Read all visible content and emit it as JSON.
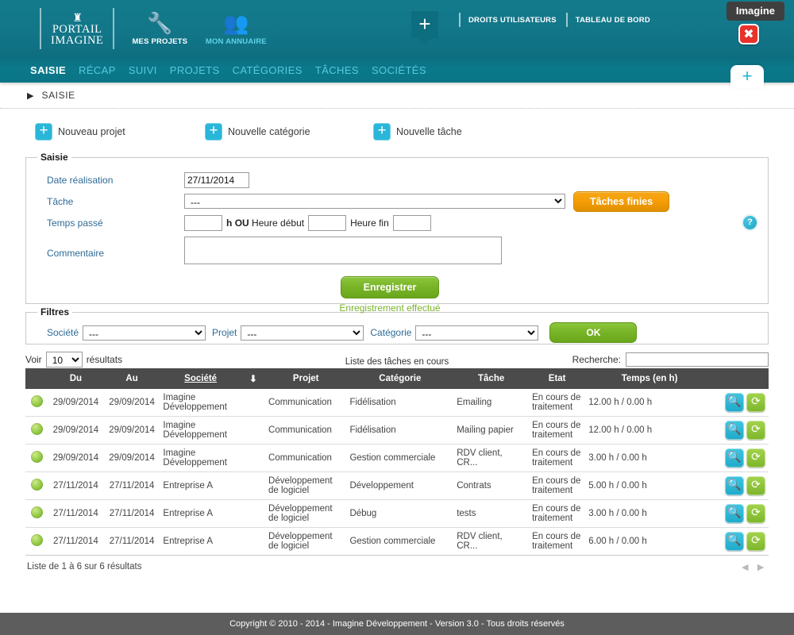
{
  "header": {
    "logo_line1": "PORTAIL",
    "logo_line2": "IMAGINE",
    "items": [
      {
        "icon": "wrench-icon",
        "label": "MES PROJETS"
      },
      {
        "icon": "people-icon",
        "label": "MON ANNUAIRE"
      }
    ],
    "plus_label": "+",
    "links": [
      {
        "label": "DROITS UTILISATEURS"
      },
      {
        "label": "TABLEAU DE BORD"
      }
    ],
    "user_badge": "Imagine",
    "close_label": "✖"
  },
  "nav": {
    "items": [
      {
        "label": "SAISIE",
        "active": true
      },
      {
        "label": "RÉCAP",
        "active": false
      },
      {
        "label": "SUIVI",
        "active": false
      },
      {
        "label": "PROJETS",
        "active": false
      },
      {
        "label": "CATÉGORIES",
        "active": false
      },
      {
        "label": "TÂCHES",
        "active": false
      },
      {
        "label": "SOCIÉTÉS",
        "active": false
      }
    ],
    "plus_tab": "+"
  },
  "breadcrumb": {
    "label": "SAISIE"
  },
  "actions": [
    {
      "label": "Nouveau projet"
    },
    {
      "label": "Nouvelle catégorie"
    },
    {
      "label": "Nouvelle tâche"
    }
  ],
  "saisie": {
    "legend": "Saisie",
    "date_label": "Date réalisation",
    "date_value": "27/11/2014",
    "tache_label": "Tâche",
    "tache_value": "---",
    "taches_finies_button": "Tâches finies",
    "help_icon": "?",
    "temps_label": "Temps passé",
    "temps_value": "",
    "h_label": "h",
    "ou_label": "OU",
    "heure_debut_label": "Heure début",
    "heure_debut_value": "",
    "heure_fin_label": "Heure fin",
    "heure_fin_value": "",
    "commentaire_label": "Commentaire",
    "commentaire_value": "",
    "save_button": "Enregistrer",
    "save_message": "Enregistrement effectué"
  },
  "filtres": {
    "legend": "Filtres",
    "societe_label": "Société",
    "societe_value": "---",
    "projet_label": "Projet",
    "projet_value": "---",
    "categorie_label": "Catégorie",
    "categorie_value": "---",
    "ok_button": "OK"
  },
  "toolbar": {
    "voir_label": "Voir",
    "page_size": "10",
    "resultats_label": "résultats",
    "recherche_label": "Recherche:",
    "recherche_value": ""
  },
  "table": {
    "title": "Liste des tâches en cours",
    "columns": [
      "",
      "Du",
      "Au",
      "Société",
      "",
      "Projet",
      "Catégorie",
      "Tâche",
      "Etat",
      "Temps (en h)",
      ""
    ],
    "sorted_column": "Société",
    "sort_icon": "arrow-down-icon",
    "rows": [
      {
        "status": "green",
        "du": "29/09/2014",
        "au": "29/09/2014",
        "societe": "Imagine Développement",
        "projet": "Communication",
        "categorie": "Fidélisation",
        "tache": "Emailing",
        "etat": "En cours de traitement",
        "temps": "12.00 h / 0.00 h"
      },
      {
        "status": "green",
        "du": "29/09/2014",
        "au": "29/09/2014",
        "societe": "Imagine Développement",
        "projet": "Communication",
        "categorie": "Fidélisation",
        "tache": "Mailing papier",
        "etat": "En cours de traitement",
        "temps": "12.00 h / 0.00 h"
      },
      {
        "status": "green",
        "du": "29/09/2014",
        "au": "29/09/2014",
        "societe": "Imagine Développement",
        "projet": "Communication",
        "categorie": "Gestion commerciale",
        "tache": "RDV client, CR...",
        "etat": "En cours de traitement",
        "temps": "3.00 h / 0.00 h"
      },
      {
        "status": "green",
        "du": "27/11/2014",
        "au": "27/11/2014",
        "societe": "Entreprise A",
        "projet": "Développement de logiciel",
        "categorie": "Développement",
        "tache": "Contrats",
        "etat": "En cours de traitement",
        "temps": "5.00 h / 0.00 h"
      },
      {
        "status": "green",
        "du": "27/11/2014",
        "au": "27/11/2014",
        "societe": "Entreprise A",
        "projet": "Développement de logiciel",
        "categorie": "Débug",
        "tache": "tests",
        "etat": "En cours de traitement",
        "temps": "3.00 h / 0.00 h"
      },
      {
        "status": "green",
        "du": "27/11/2014",
        "au": "27/11/2014",
        "societe": "Entreprise A",
        "projet": "Développement de logiciel",
        "categorie": "Gestion commerciale",
        "tache": "RDV client, CR...",
        "etat": "En cours de traitement",
        "temps": "6.00 h / 0.00 h"
      }
    ],
    "row_actions": [
      {
        "icon": "magnifier-icon",
        "glyph": "⌕"
      },
      {
        "icon": "refresh-icon",
        "glyph": "↻"
      }
    ],
    "footer_info": "Liste de 1 à 6 sur 6 résultats",
    "pager_prev": "◄",
    "pager_next": "►"
  },
  "footer": {
    "copyright": "Copyright © 2010 - 2014 - Imagine Développement - Version 3.0 - Tous droits réservés"
  },
  "colors": {
    "teal": "#12788a",
    "nav_teal": "#0b798b",
    "cyan": "#2ab6d9",
    "green": "#79b527",
    "orange": "#f59d05",
    "red": "#e8322a",
    "header_dark": "#4b4b4b"
  }
}
